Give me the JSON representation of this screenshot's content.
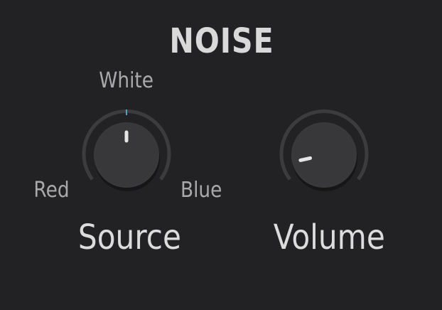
{
  "panel": {
    "title": "NOISE"
  },
  "source_knob": {
    "label": "Source",
    "option_left": "Red",
    "option_top": "White",
    "option_right": "Blue",
    "selected": "White"
  },
  "volume_knob": {
    "label": "Volume",
    "value_fraction": 0.12
  },
  "colors": {
    "background": "#222224",
    "knob_body": "#3a3a3c",
    "arc": "#3c3c3f",
    "indicator": "#e6e6e6",
    "center_tick": "#3aa6d8"
  }
}
